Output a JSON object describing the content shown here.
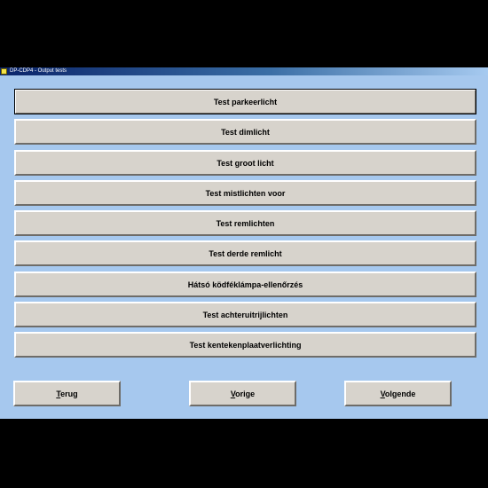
{
  "window": {
    "title": "DP-CDP4 - Output tests"
  },
  "tests": [
    {
      "label": "Test parkeerlicht"
    },
    {
      "label": "Test dimlicht"
    },
    {
      "label": "Test groot licht"
    },
    {
      "label": "Test mistlichten voor"
    },
    {
      "label": "Test remlichten"
    },
    {
      "label": "Test derde remlicht"
    },
    {
      "label": "Hátsó ködféklámpa-ellenőrzés"
    },
    {
      "label": "Test achteruitrijlichten"
    },
    {
      "label": "Test kentekenplaatverlichting"
    }
  ],
  "nav": {
    "back_label": "Terug",
    "prev_label": "Vorige",
    "next_label": "Volgende"
  },
  "colors": {
    "window_background": "#a6c8ee",
    "button_face": "#d7d3cc",
    "titlebar_start": "#0a246a",
    "titlebar_end": "#a6caf0"
  }
}
